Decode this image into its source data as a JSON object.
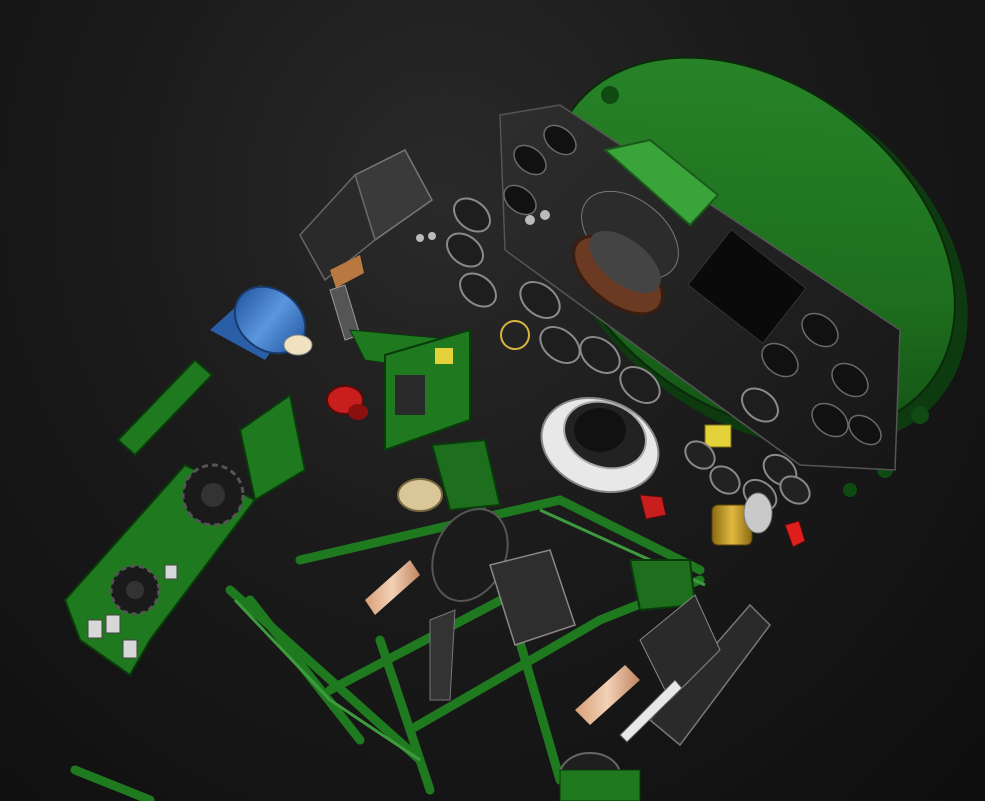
{
  "scene": {
    "colors": {
      "background_center": "#2a2a2a",
      "background_edge": "#0e0e0e",
      "green_primary": "#1f7a1f",
      "green_dark": "#0f4a12",
      "green_light": "#4fb24a",
      "panel_black": "#1b1b1b",
      "panel_gray": "#3a3a3a",
      "blue_part": "#3b78c9",
      "red_part": "#c81e1e",
      "yellow_part": "#e3d23a",
      "gold_part": "#c9a227",
      "tan_part": "#d9c79a",
      "white_part": "#e8e8e8",
      "copper_part": "#b9783f"
    }
  }
}
